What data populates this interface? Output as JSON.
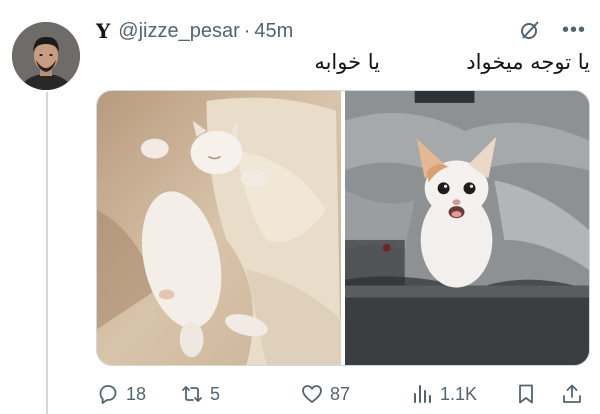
{
  "tweet": {
    "author": {
      "display_name": "Y",
      "handle": "@jizze_pesar",
      "separator": "·",
      "time": "45m"
    },
    "caption_right": "یا توجه میخواد",
    "caption_left": "یا خوابه",
    "media": [
      {
        "icon": "sleeping-white-kitten-photo"
      },
      {
        "icon": "meowing-calico-kitten-photo"
      }
    ],
    "actions": {
      "replies": "18",
      "reposts": "5",
      "likes": "87",
      "views": "1.1K"
    }
  },
  "colors": {
    "text_primary": "#0f1419",
    "text_secondary": "#536471",
    "thread_line": "#cfd9de"
  }
}
